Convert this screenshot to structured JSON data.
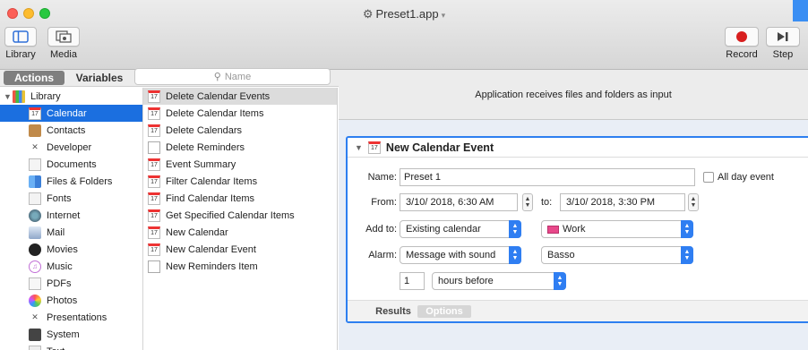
{
  "window": {
    "title": "Preset1.app"
  },
  "toolbar": {
    "library_label": "Library",
    "media_label": "Media",
    "record_label": "Record",
    "step_label": "Step"
  },
  "library_pane": {
    "tab_actions": "Actions",
    "tab_variables": "Variables",
    "search_placeholder": "Name",
    "root_label": "Library",
    "categories": [
      {
        "label": "Calendar",
        "icon": "calendar-icon",
        "selected": true
      },
      {
        "label": "Contacts",
        "icon": "contacts-icon"
      },
      {
        "label": "Developer",
        "icon": "developer-icon"
      },
      {
        "label": "Documents",
        "icon": "documents-icon"
      },
      {
        "label": "Files & Folders",
        "icon": "finder-icon"
      },
      {
        "label": "Fonts",
        "icon": "fonts-icon"
      },
      {
        "label": "Internet",
        "icon": "globe-icon"
      },
      {
        "label": "Mail",
        "icon": "mail-icon"
      },
      {
        "label": "Movies",
        "icon": "movies-icon"
      },
      {
        "label": "Music",
        "icon": "music-icon"
      },
      {
        "label": "PDFs",
        "icon": "pdf-icon"
      },
      {
        "label": "Photos",
        "icon": "photos-icon"
      },
      {
        "label": "Presentations",
        "icon": "presentations-icon"
      },
      {
        "label": "System",
        "icon": "system-icon"
      },
      {
        "label": "Text",
        "icon": "text-icon"
      }
    ],
    "actions": [
      {
        "label": "Delete Calendar Events",
        "icon": "calendar-icon",
        "highlighted": true
      },
      {
        "label": "Delete Calendar Items",
        "icon": "calendar-icon"
      },
      {
        "label": "Delete Calendars",
        "icon": "calendar-icon"
      },
      {
        "label": "Delete Reminders",
        "icon": "reminders-icon"
      },
      {
        "label": "Event Summary",
        "icon": "calendar-icon"
      },
      {
        "label": "Filter Calendar Items",
        "icon": "calendar-icon"
      },
      {
        "label": "Find Calendar Items",
        "icon": "calendar-icon"
      },
      {
        "label": "Get Specified Calendar Items",
        "icon": "calendar-icon"
      },
      {
        "label": "New Calendar",
        "icon": "calendar-icon"
      },
      {
        "label": "New Calendar Event",
        "icon": "calendar-icon"
      },
      {
        "label": "New Reminders Item",
        "icon": "reminders-icon"
      }
    ]
  },
  "workflow": {
    "input_text": "Application receives files and folders as input",
    "action": {
      "title": "New Calendar Event",
      "name_label": "Name:",
      "name_value": "Preset 1",
      "all_day_label": "All day event",
      "from_label": "From:",
      "from_value": "3/10/ 2018,  6:30 AM",
      "to_label": "to:",
      "to_value": "3/10/ 2018,  3:30 PM",
      "add_to_label": "Add to:",
      "add_to_value": "Existing calendar",
      "calendar_value": "Work",
      "calendar_color": "#e8488a",
      "alarm_label": "Alarm:",
      "alarm_value": "Message with sound",
      "sound_value": "Basso",
      "alarm_amount": "1",
      "alarm_unit": "hours before",
      "results_tab": "Results",
      "options_tab": "Options"
    }
  },
  "colors": {
    "accent": "#2f7ef2",
    "selection": "#1b6fe0"
  }
}
